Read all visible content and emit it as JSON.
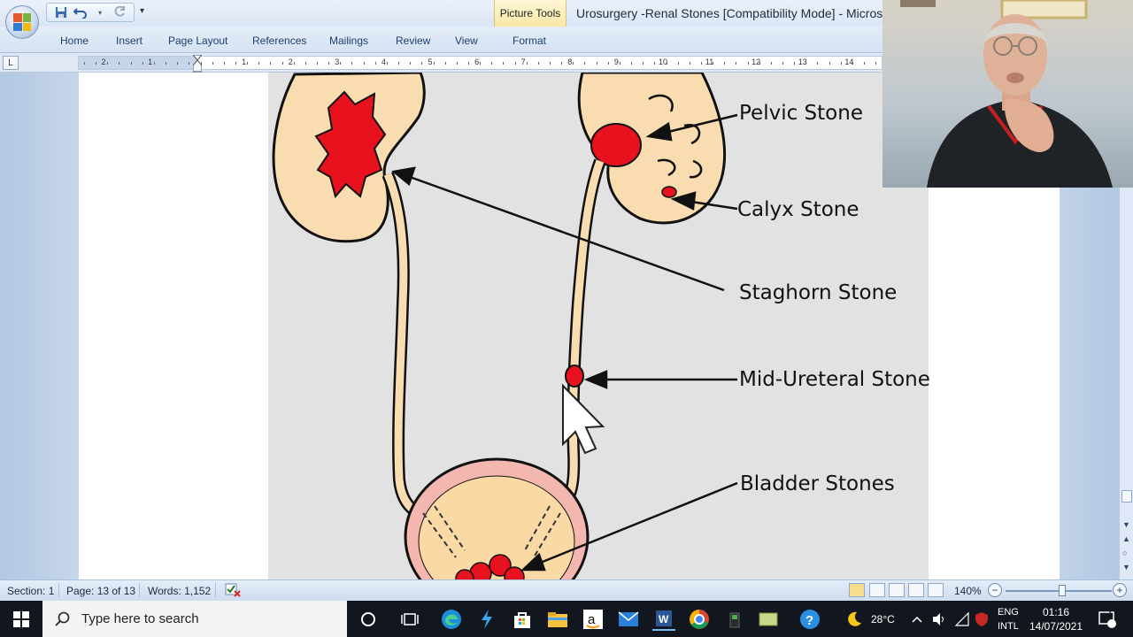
{
  "titlebar": {
    "contextual_tab": "Picture Tools",
    "document_title": "Urosurgery -Renal Stones [Compatibility Mode] - Micros"
  },
  "ribbon": {
    "tabs": [
      "Home",
      "Insert",
      "Page Layout",
      "References",
      "Mailings",
      "Review",
      "View",
      "Format"
    ]
  },
  "ruler": {
    "corner": "L",
    "left_numbers": [
      "2",
      "1"
    ],
    "right_numbers": [
      "1",
      "2",
      "3",
      "4",
      "5",
      "6",
      "7",
      "8",
      "9",
      "10",
      "11",
      "12",
      "13",
      "14"
    ]
  },
  "figure": {
    "labels": {
      "pelvic": "Pelvic Stone",
      "calyx": "Calyx Stone",
      "staghorn": "Staghorn Stone",
      "mid_ureteral": "Mid-Ureteral Stone",
      "bladder": "Bladder Stones"
    }
  },
  "statusbar": {
    "section": "Section: 1",
    "page": "Page: 13 of 13",
    "words": "Words: 1,152",
    "zoom": "140%",
    "zoom_minus": "−",
    "zoom_plus": "+"
  },
  "taskbar": {
    "search_placeholder": "Type here to search",
    "temperature": "28°C",
    "lang_top": "ENG",
    "lang_bottom": "INTL",
    "time": "01:16",
    "date": "14/07/2021",
    "notification_count": "1"
  },
  "colors": {
    "stone_red": "#e8121f",
    "kidney_fill": "#f9ddb0",
    "bladder_wall": "#f4b7b0",
    "ribbon_bg": "#dbe6f4",
    "taskbar_bg": "#12171f"
  }
}
